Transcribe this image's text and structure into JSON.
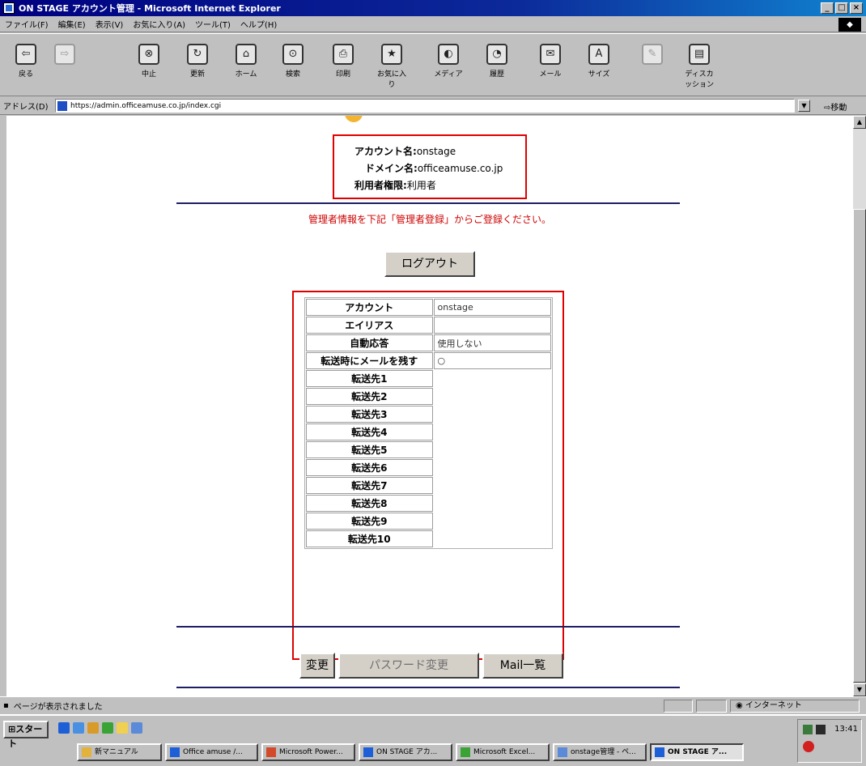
{
  "window": {
    "title": "ON STAGE アカウント管理 - Microsoft Internet Explorer",
    "controls": [
      "_",
      "□",
      "×"
    ]
  },
  "menubar": {
    "items": [
      "ファイル(F)",
      "編集(E)",
      "表示(V)",
      "お気に入り(A)",
      "ツール(T)",
      "ヘルプ(H)"
    ]
  },
  "toolbar": {
    "buttons": [
      {
        "label": "戻る",
        "icon": "back-arrow-icon",
        "glyph": "⇦",
        "disabled": false
      },
      {
        "label": "",
        "icon": "forward-arrow-icon",
        "glyph": "⇨",
        "disabled": true
      },
      {
        "label": "中止",
        "icon": "stop-icon",
        "glyph": "⊗",
        "disabled": false
      },
      {
        "label": "更新",
        "icon": "refresh-icon",
        "glyph": "↻",
        "disabled": false
      },
      {
        "label": "ホーム",
        "icon": "home-icon",
        "glyph": "⌂",
        "disabled": false
      },
      {
        "label": "検索",
        "icon": "search-icon",
        "glyph": "⊙",
        "disabled": false
      },
      {
        "label": "印刷",
        "icon": "print-icon",
        "glyph": "⎙",
        "disabled": false
      },
      {
        "label": "お気に入り",
        "icon": "favorites-icon",
        "glyph": "★",
        "disabled": false
      },
      {
        "label": "メディア",
        "icon": "media-icon",
        "glyph": "◐",
        "disabled": false
      },
      {
        "label": "履歴",
        "icon": "history-icon",
        "glyph": "◔",
        "disabled": false
      },
      {
        "label": "メール",
        "icon": "mail-icon",
        "glyph": "✉",
        "disabled": false
      },
      {
        "label": "サイズ",
        "icon": "size-icon",
        "glyph": "A",
        "disabled": false
      },
      {
        "label": "",
        "icon": "edit-icon",
        "glyph": "✎",
        "disabled": true
      },
      {
        "label": "ディスカッション",
        "icon": "discussion-icon",
        "glyph": "▤",
        "disabled": false
      }
    ]
  },
  "address": {
    "label": "アドレス(D)",
    "url": "https://admin.officeamuse.co.jp/index.cgi",
    "go_label": "移動"
  },
  "account_info": {
    "account_key": "アカウント名:",
    "account_value": "onstage",
    "domain_key": "ドメイン名:",
    "domain_value": "officeamuse.co.jp",
    "role_key": "利用者権限:",
    "role_value": "利用者"
  },
  "notice": "管理者情報を下記「管理者登録」からご登録ください。",
  "buttons": {
    "logout": "ログアウト",
    "change": "変更",
    "password_change": "パスワード変更",
    "mail_list": "Mail一覧"
  },
  "table": {
    "rows": [
      {
        "key": "アカウント",
        "value": "onstage"
      },
      {
        "key": "エイリアス",
        "value": ""
      },
      {
        "key": "自動応答",
        "value": "使用しない"
      },
      {
        "key": "転送時にメールを残す",
        "value": "○"
      },
      {
        "key": "転送先1",
        "value": null
      },
      {
        "key": "転送先2",
        "value": null
      },
      {
        "key": "転送先3",
        "value": null
      },
      {
        "key": "転送先4",
        "value": null
      },
      {
        "key": "転送先5",
        "value": null
      },
      {
        "key": "転送先6",
        "value": null
      },
      {
        "key": "転送先7",
        "value": null
      },
      {
        "key": "転送先8",
        "value": null
      },
      {
        "key": "転送先9",
        "value": null
      },
      {
        "key": "転送先10",
        "value": null
      }
    ]
  },
  "status": {
    "message": "ページが表示されました",
    "zone": "インターネット"
  },
  "taskbar": {
    "start": "スタート",
    "tasks": [
      "新マニュアル",
      "Office amuse /...",
      "Microsoft Power...",
      "ON STAGE アカ...",
      "Microsoft Excel...",
      "onstage管理 - ペ...",
      "ON STAGE ア..."
    ],
    "clock": "13:41"
  },
  "colors": {
    "highlight_border": "#e00000",
    "notice_text": "#cc0000",
    "rule": "#1e1e66",
    "titlebar": "#000080"
  }
}
